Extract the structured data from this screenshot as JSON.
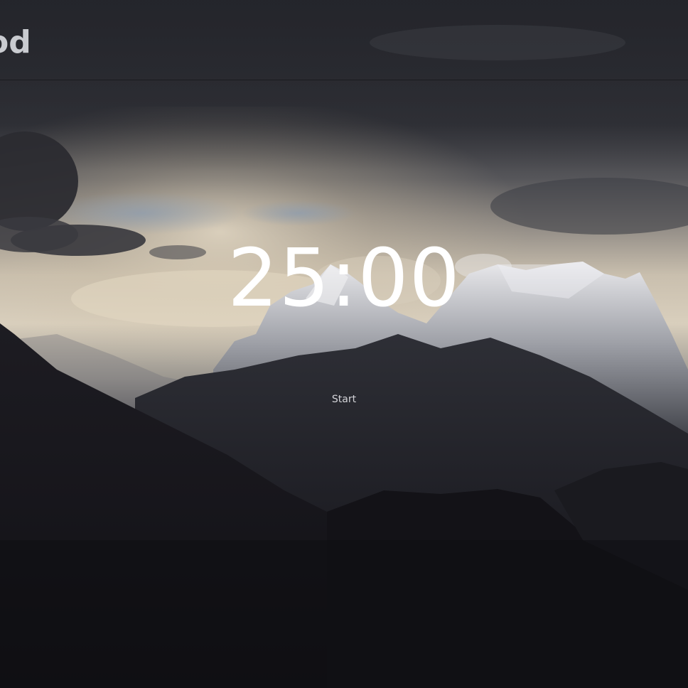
{
  "header": {
    "logo_text": "od"
  },
  "timer": {
    "display": "25:00"
  },
  "controls": {
    "start_label": "Start"
  },
  "colors": {
    "sky_dark": "#2b2c33",
    "cloud_light": "#e6dccb",
    "mountain_dark": "#141318",
    "text_primary": "#ffffff",
    "text_muted": "#d4d4d8"
  }
}
